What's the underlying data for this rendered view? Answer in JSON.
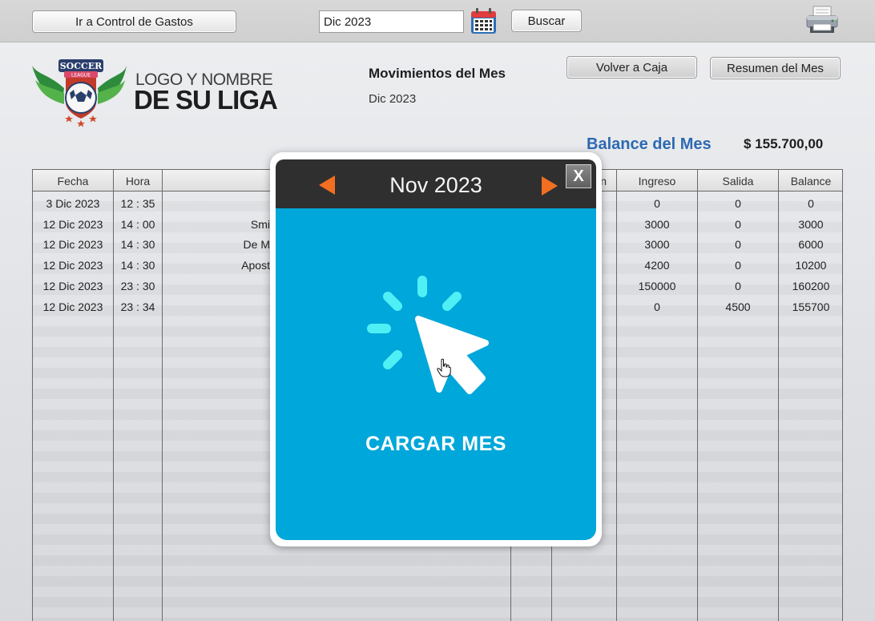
{
  "toolbar": {
    "go_expenses_label": "Ir a Control de Gastos",
    "month_value": "Dic 2023",
    "search_label": "Buscar",
    "calendar_icon": "calendar-icon",
    "print_icon": "printer-icon"
  },
  "branding": {
    "badge_text": "SOCCER",
    "badge_sub": "LEAGUE",
    "line1": "LOGO Y NOMBRE",
    "line2": "DE SU LIGA"
  },
  "header": {
    "title": "Movimientos del Mes",
    "subtitle": "Dic 2023",
    "back_label": "Volver a Caja",
    "summary_label": "Resumen del Mes",
    "balance_label": "Balance del Mes",
    "balance_value": "$ 155.700,00"
  },
  "table": {
    "columns": {
      "fecha": "Fecha",
      "hora": "Hora",
      "ingreso": "Ingreso",
      "salida": "Salida",
      "balance": "Balance",
      "partial": "n"
    },
    "rows": [
      {
        "fecha": "3 Dic 2023",
        "hora": "12 : 35",
        "desc": "",
        "ingreso": "0",
        "salida": "0",
        "balance": "0"
      },
      {
        "fecha": "12 Dic 2023",
        "hora": "14 : 00",
        "desc": "Smi",
        "ingreso": "3000",
        "salida": "0",
        "balance": "3000"
      },
      {
        "fecha": "12 Dic 2023",
        "hora": "14 : 30",
        "desc": "De M",
        "ingreso": "3000",
        "salida": "0",
        "balance": "6000"
      },
      {
        "fecha": "12 Dic 2023",
        "hora": "14 : 30",
        "desc": "Apost",
        "ingreso": "4200",
        "salida": "0",
        "balance": "10200"
      },
      {
        "fecha": "12 Dic 2023",
        "hora": "23 : 30",
        "desc": "",
        "ingreso": "150000",
        "salida": "0",
        "balance": "160200"
      },
      {
        "fecha": "12 Dic 2023",
        "hora": "23 : 34",
        "desc": "",
        "ingreso": "0",
        "salida": "4500",
        "balance": "155700"
      }
    ]
  },
  "modal": {
    "month": "Nov 2023",
    "close_label": "X",
    "action_label": "CARGAR MES",
    "accent_color": "#00a7da",
    "arrow_color": "#f26f21"
  }
}
